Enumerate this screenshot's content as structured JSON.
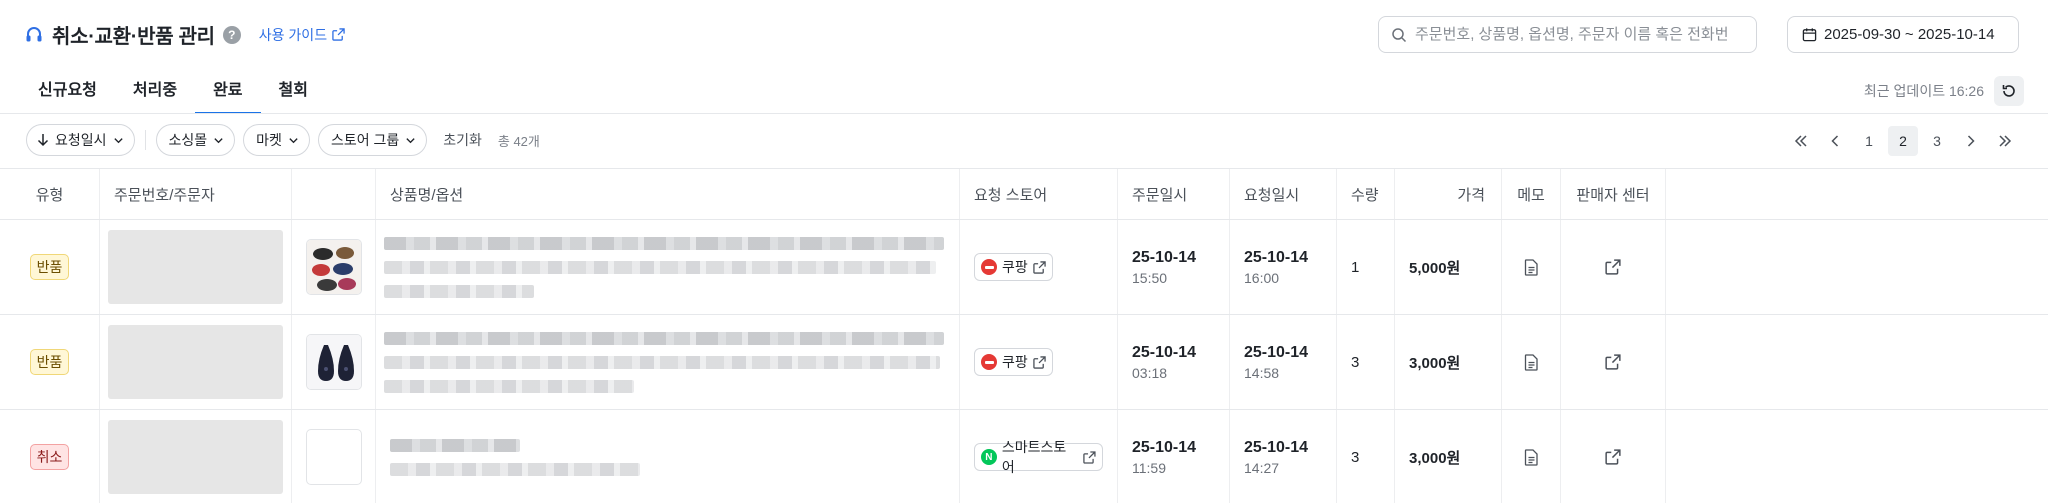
{
  "header": {
    "title": "취소·교환·반품 관리",
    "guide_label": "사용 가이드",
    "search_placeholder": "주문번호, 상품명, 옵션명, 주문자 이름 혹은 전화번",
    "date_range": "2025-09-30 ~ 2025-10-14"
  },
  "tabs": [
    {
      "label": "신규요청",
      "active": false
    },
    {
      "label": "처리중",
      "active": false
    },
    {
      "label": "완료",
      "active": true
    },
    {
      "label": "철회",
      "active": false
    }
  ],
  "update_text": "최근 업데이트 16:26",
  "filters": {
    "sort_label": "요청일시",
    "chips": [
      "소싱몰",
      "마켓",
      "스토어 그룹"
    ],
    "reset_label": "초기화",
    "total_label": "총 42개"
  },
  "pagination": {
    "pages": [
      "1",
      "2",
      "3"
    ],
    "current": "2"
  },
  "table": {
    "headers": {
      "type": "유형",
      "order": "주문번호/주문자",
      "product": "상품명/옵션",
      "store": "요청 스토어",
      "order_date": "주문일시",
      "request_date": "요청일시",
      "qty": "수량",
      "price": "가격",
      "memo": "메모",
      "seller": "판매자 센터"
    },
    "rows": [
      {
        "type": "반품",
        "type_kind": "return",
        "store": "쿠팡",
        "store_kind": "coupang",
        "order_date": "25-10-14",
        "order_time": "15:50",
        "request_date": "25-10-14",
        "request_time": "16:00",
        "qty": "1",
        "price": "5,000원"
      },
      {
        "type": "반품",
        "type_kind": "return",
        "store": "쿠팡",
        "store_kind": "coupang",
        "order_date": "25-10-14",
        "order_time": "03:18",
        "request_date": "25-10-14",
        "request_time": "14:58",
        "qty": "3",
        "price": "3,000원"
      },
      {
        "type": "취소",
        "type_kind": "cancel",
        "store": "스마트스토어",
        "store_kind": "naver",
        "order_date": "25-10-14",
        "order_time": "11:59",
        "request_date": "25-10-14",
        "request_time": "14:27",
        "qty": "3",
        "price": "3,000원"
      }
    ]
  },
  "colors": {
    "accent": "#1a73e8",
    "link": "#2f6fe4",
    "coupang": "#e53935",
    "naver": "#03c75a"
  }
}
